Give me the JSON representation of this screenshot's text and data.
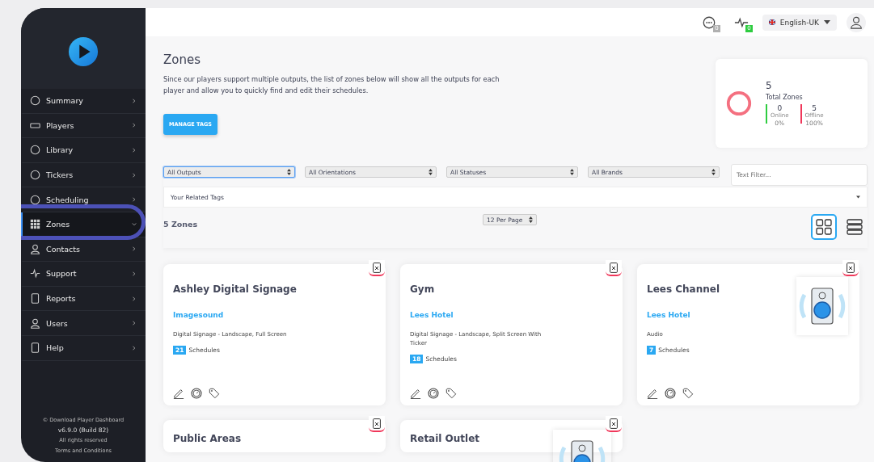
{
  "topbar": {
    "badges": [
      {
        "count": "0",
        "color": "#b0b0b0"
      },
      {
        "count": "0",
        "color": "#2ecc40"
      }
    ],
    "language": "English-UK"
  },
  "sidebar": {
    "items": [
      {
        "label": "Summary",
        "selected": false
      },
      {
        "label": "Players",
        "selected": false
      },
      {
        "label": "Library",
        "selected": false
      },
      {
        "label": "Tickers",
        "selected": false
      },
      {
        "label": "Scheduling",
        "selected": false
      },
      {
        "label": "Zones",
        "selected": true
      },
      {
        "label": "Contacts",
        "selected": false
      },
      {
        "label": "Support",
        "selected": false
      },
      {
        "label": "Reports",
        "selected": false
      },
      {
        "label": "Users",
        "selected": false
      },
      {
        "label": "Help",
        "selected": false
      }
    ],
    "footer": [
      "© Download Player Dashboard",
      "v6.9.0 (Build 82)",
      "All rights reserved",
      "Terms and Conditions"
    ]
  },
  "header": {
    "title": "Zones",
    "description": "Since our players support multiple outputs, the list of zones below will show all the outputs for each player and allow you to quickly find and edit their schedules.",
    "button": "MANAGE TAGS"
  },
  "summary": {
    "total": "5",
    "label": "Total Zones",
    "stats": [
      {
        "value": "0",
        "label": "Online",
        "percent": "0%",
        "color": "#2ecc40"
      },
      {
        "value": "5",
        "label": "Offline",
        "percent": "100%",
        "color": "#f0375a"
      }
    ]
  },
  "filters": [
    {
      "value": "All Outputs",
      "focused": true
    },
    {
      "value": "All Orientations",
      "focused": false
    },
    {
      "value": "All Statuses",
      "focused": false
    },
    {
      "value": "All Brands",
      "focused": false
    }
  ],
  "text_filter": {
    "placeholder": "Text Filter..."
  },
  "tags": {
    "placeholder": "Your Related Tags"
  },
  "count_label": "5 Zones",
  "per_page": "12 Per Page",
  "views": [
    {
      "kind": "grid",
      "selected": true
    },
    {
      "kind": "list",
      "selected": false
    }
  ],
  "cards": [
    {
      "title": "Ashley Digital Signage",
      "brand": "Imagesound",
      "description": "Digital Signage - Landscape, Full Screen",
      "schedules": "21",
      "schedules_label": "Schedules",
      "image": false
    },
    {
      "title": "Gym",
      "brand": "Lees Hotel",
      "description": "Digital Signage - Landscape, Split Screen With Ticker",
      "schedules": "18",
      "schedules_label": "Schedules",
      "image": false
    },
    {
      "title": "Lees Channel",
      "brand": "Lees Hotel",
      "description": "Audio",
      "schedules": "7",
      "schedules_label": "Schedules",
      "image": true
    },
    {
      "title": "Public Areas",
      "image": false
    },
    {
      "title": "Retail Outlet",
      "image": true
    }
  ]
}
